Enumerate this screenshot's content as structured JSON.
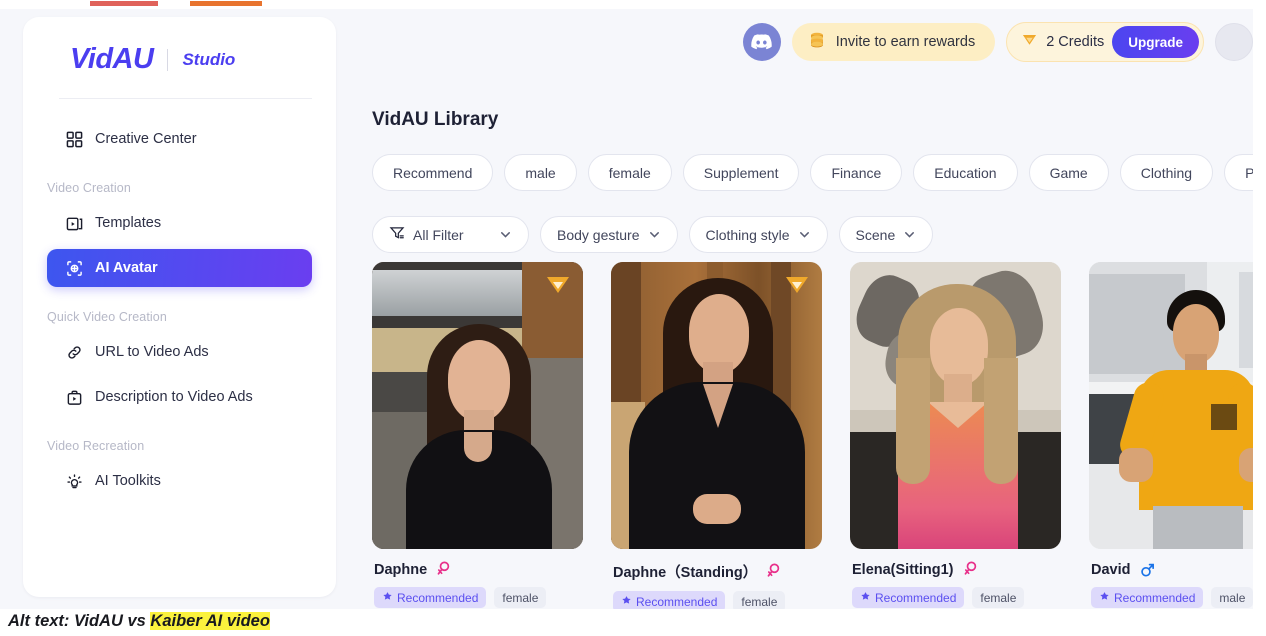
{
  "brand": {
    "logo": "VidAU",
    "sub": "Studio"
  },
  "header": {
    "discord_icon": "discord-icon",
    "invite": {
      "icon": "coins-icon",
      "label": "Invite to earn rewards"
    },
    "credits": {
      "icon": "diamond-icon",
      "label": "2 Credits",
      "upgrade_label": "Upgrade"
    }
  },
  "sidebar": {
    "items": [
      {
        "label": "Creative Center",
        "icon": "grid-icon",
        "active": false
      },
      {
        "label": "Templates",
        "icon": "template-icon",
        "active": false
      },
      {
        "label": "AI Avatar",
        "icon": "avatar-frame-icon",
        "active": true
      },
      {
        "label": "URL to Video Ads",
        "icon": "link-icon",
        "active": false
      },
      {
        "label": "Description to Video Ads",
        "icon": "description-icon",
        "active": false
      },
      {
        "label": "AI Toolkits",
        "icon": "lightbulb-icon",
        "active": false
      }
    ],
    "groups": {
      "video_creation": "Video Creation",
      "quick_video_creation": "Quick Video Creation",
      "video_recreation": "Video Recreation"
    }
  },
  "main": {
    "title": "VidAU Library",
    "chips": [
      "Recommend",
      "male",
      "female",
      "Supplement",
      "Finance",
      "Education",
      "Game",
      "Clothing",
      "Pet"
    ],
    "filters": [
      {
        "label": "All Filter",
        "icon": "funnel-icon"
      },
      {
        "label": "Body gesture",
        "icon": ""
      },
      {
        "label": "Clothing style",
        "icon": ""
      },
      {
        "label": "Scene",
        "icon": ""
      }
    ],
    "cards": [
      {
        "name": "Daphne",
        "gender": "female",
        "premium": true,
        "tags": [
          "Recommended",
          "female"
        ]
      },
      {
        "name": "Daphne（Standing）",
        "gender": "female",
        "premium": true,
        "tags": [
          "Recommended",
          "female"
        ]
      },
      {
        "name": "Elena(Sitting1)",
        "gender": "female",
        "premium": false,
        "tags": [
          "Recommended",
          "female"
        ]
      },
      {
        "name": "David",
        "gender": "male",
        "premium": false,
        "tags": [
          "Recommended",
          "male"
        ]
      }
    ]
  },
  "caption": {
    "prefix": "Alt text: VidAU vs ",
    "highlight": "Kaiber AI video"
  },
  "colors": {
    "accent": "#4b3ef0",
    "active_gradient_start": "#3d56ef",
    "active_gradient_end": "#6a3ef0",
    "female": "#e8308a",
    "male": "#1a73e8",
    "gold": "#f0a92b",
    "highlight": "#fbf23d"
  }
}
